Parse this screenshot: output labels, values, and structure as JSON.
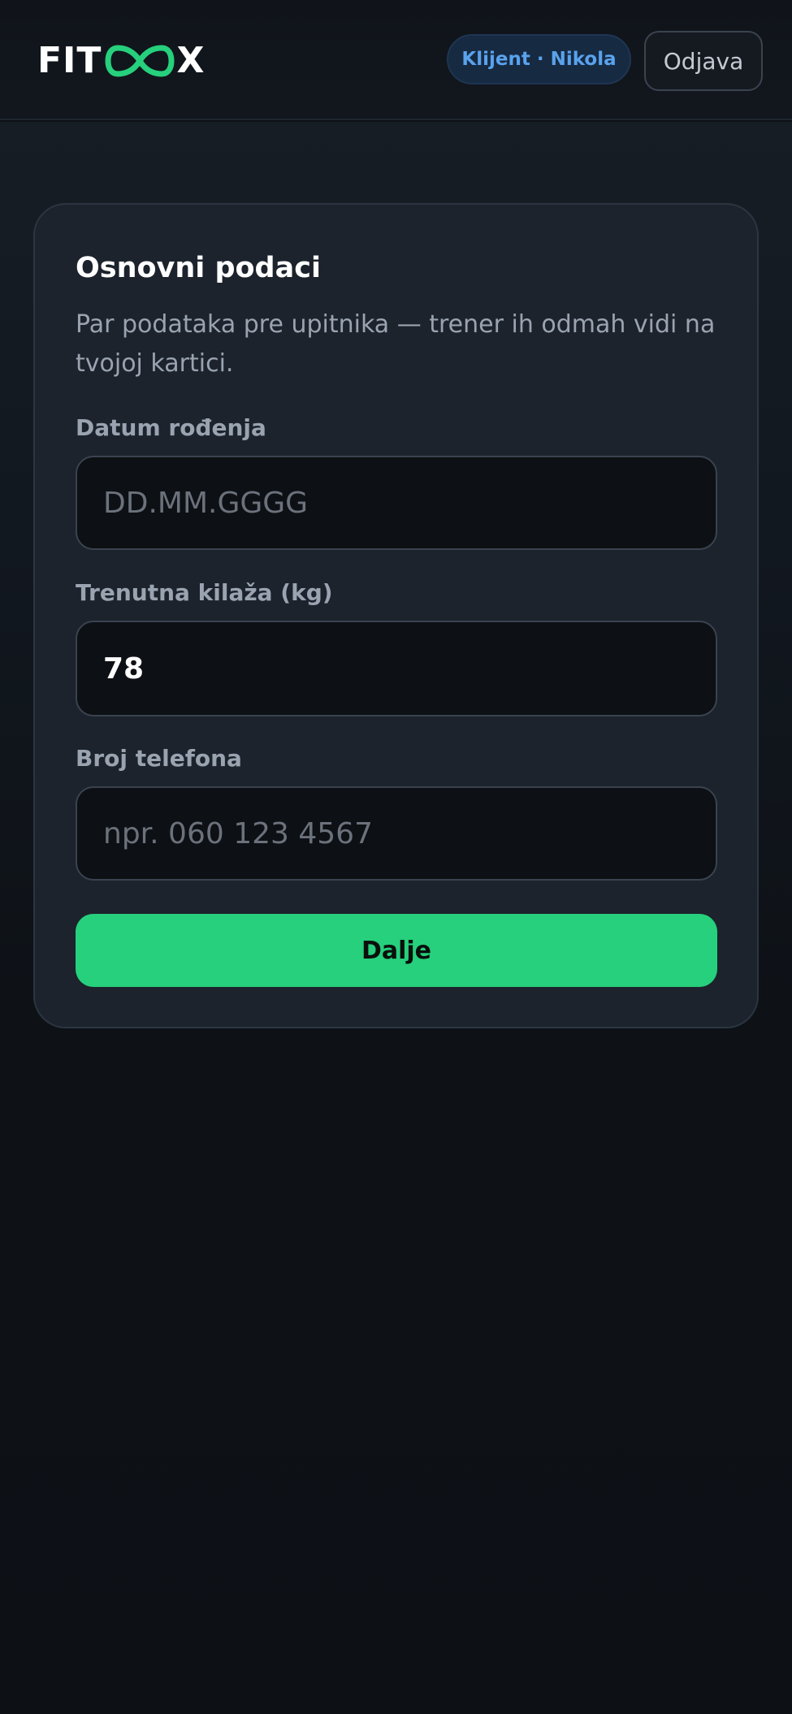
{
  "header": {
    "logo": {
      "left_text": "FIT",
      "right_text": "X",
      "icon": "infinity-icon"
    },
    "badge": "Klijent · Nikola",
    "logout_label": "Odjava"
  },
  "card": {
    "title": "Osnovni podaci",
    "description": "Par podataka pre upitnika — trener ih odmah vidi na tvojoj kartici.",
    "fields": [
      {
        "label": "Datum rođenja",
        "value": "",
        "placeholder": "DD.MM.GGGG"
      },
      {
        "label": "Trenutna kilaža (kg)",
        "value": "78",
        "placeholder": ""
      },
      {
        "label": "Broj telefona",
        "value": "",
        "placeholder": "npr. 060 123 4567"
      }
    ],
    "submit_label": "Dalje"
  },
  "colors": {
    "accent": "#26d07c",
    "badge_text": "#5aa2ec",
    "background": "#0d1015",
    "card": "#1c232d"
  }
}
